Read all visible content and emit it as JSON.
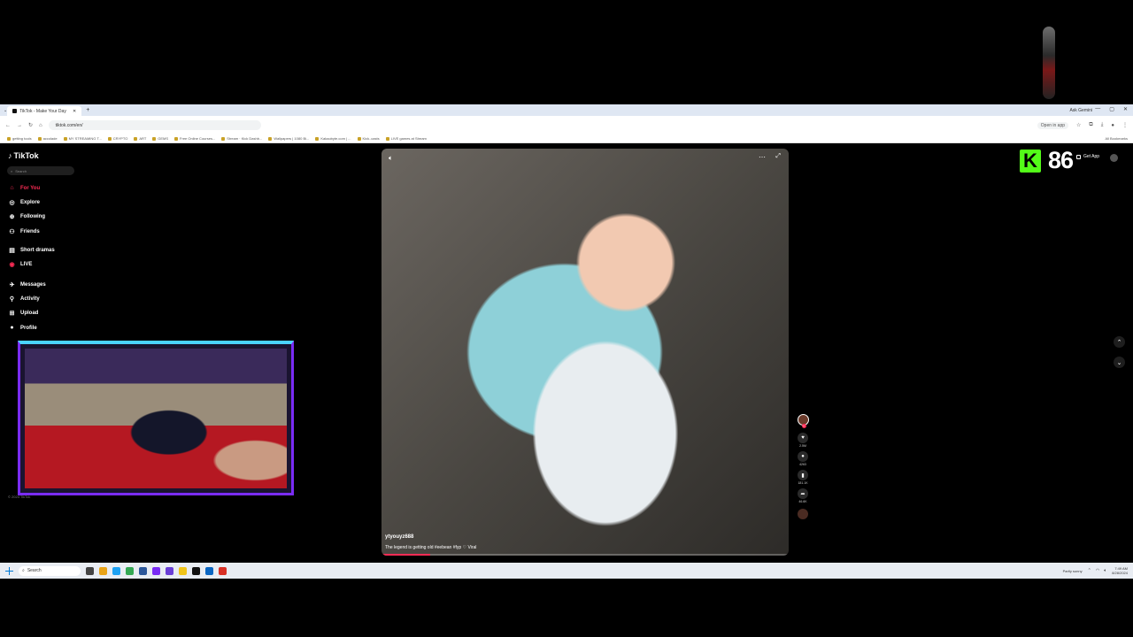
{
  "browser": {
    "tab_title": "TikTok - Make Your Day",
    "new_tab": "+",
    "ask_gemini": "Ask Gemini",
    "url": "tiktok.com/en/",
    "open_in_app": "Open in app",
    "bookmarks": [
      "getting tools",
      "accolade",
      "MY STREAMING T...",
      "CRYPTO",
      "ART",
      "GEMS",
      "Free Online Courses...",
      "Stream · Kick Dashb...",
      "Wallpapers | 1080 Bi...",
      "Kakaobyte.com | ...",
      "Kick..casts",
      "LIVE games at Stream"
    ],
    "all_bookmarks": "All Bookmarks"
  },
  "tiktok": {
    "logo": "TikTok",
    "search_placeholder": "Search",
    "nav": {
      "for_you": "For You",
      "explore": "Explore",
      "following": "Following",
      "friends": "Friends",
      "short_dramas": "Short dramas",
      "live": "LIVE",
      "messages": "Messages",
      "activity": "Activity",
      "upload": "Upload",
      "profile": "Profile"
    },
    "footer": "© 2024 TikTok",
    "get_app": "Get App",
    "video": {
      "author": "ytyouyz688",
      "caption": "The legend is getting old #eebean #fyp ♡ Viral",
      "progress": 0.12
    },
    "actions": {
      "likes": "2.5M",
      "comments": "4263",
      "saves": "181.1K",
      "shares": "46.6K"
    }
  },
  "overlay": {
    "k_letter": "K",
    "viewer_count": "86"
  },
  "taskbar": {
    "search": "Search",
    "weather": "Partly sunny",
    "time": "7:49 AM",
    "date": "8/28/2024"
  }
}
